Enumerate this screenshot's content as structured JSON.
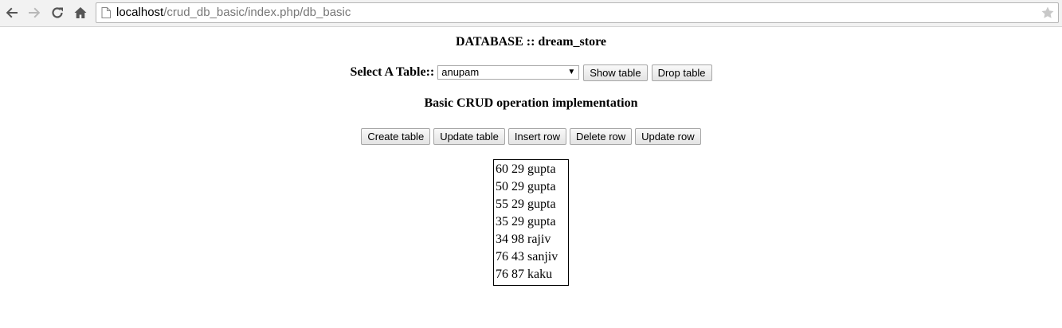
{
  "browser": {
    "url_host": "localhost",
    "url_path": "/crud_db_basic/index.php/db_basic",
    "icons": [
      "back-icon",
      "forward-icon",
      "reload-icon",
      "home-icon",
      "page-icon",
      "star-icon"
    ]
  },
  "page": {
    "database_heading": "DATABASE :: dream_store",
    "select_label": "Select A Table::",
    "selected_table": "anupam",
    "show_table_label": "Show table",
    "drop_table_label": "Drop table",
    "crud_heading": "Basic CRUD operation implementation",
    "crud_buttons": [
      "Create table",
      "Update table",
      "Insert row",
      "Delete row",
      "Update row"
    ],
    "rows": [
      "60 29 gupta",
      "50 29 gupta",
      "55 29 gupta",
      "35 29 gupta",
      "34 98 rajiv",
      "76 43 sanjiv",
      "76 87 kaku"
    ]
  }
}
